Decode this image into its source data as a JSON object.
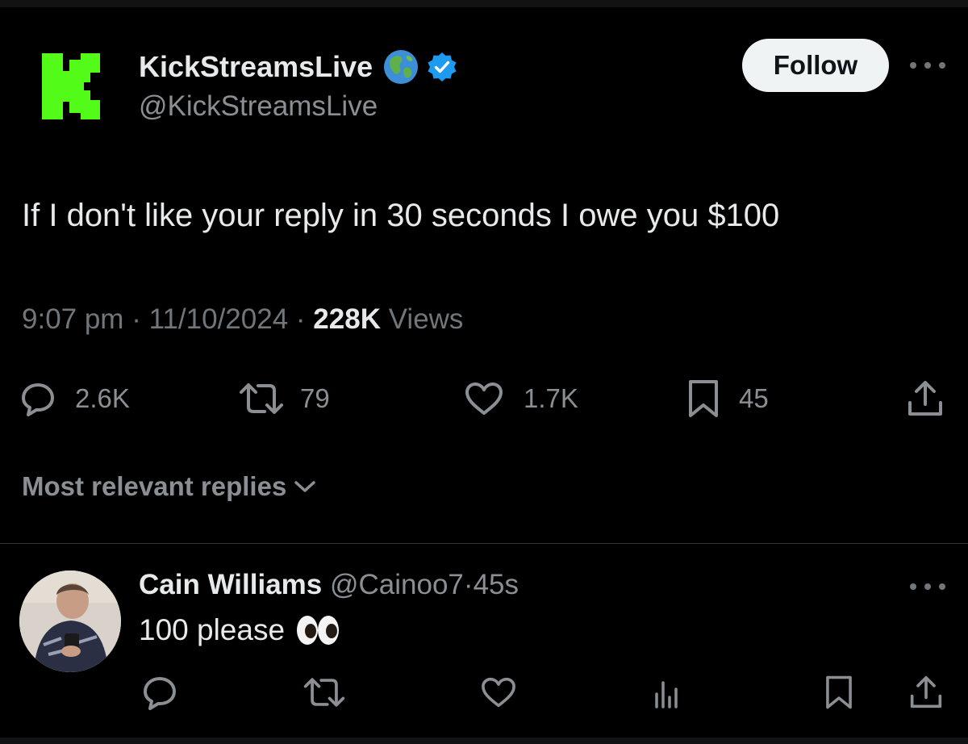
{
  "tweet": {
    "author_name": "KickStreamsLive",
    "author_handle": "@KickStreamsLive",
    "follow_label": "Follow",
    "text": "If I don't like your reply in 30 seconds I owe you $100",
    "time": "9:07 pm",
    "date": "11/10/2024",
    "views_count": "228K",
    "views_label": "Views",
    "separator": "·",
    "stats": {
      "replies": "2.6K",
      "reposts": "79",
      "likes": "1.7K",
      "bookmarks": "45"
    }
  },
  "replies_section": {
    "sort_label": "Most relevant replies"
  },
  "reply": {
    "name": "Cain Williams",
    "handle": "@Cainoo7",
    "time": "45s",
    "text": "100 please"
  },
  "icons": {
    "logo": "kick-logo",
    "globe": "globe-emoji",
    "verified": "verified-badge-icon",
    "reply": "speech-bubble-icon",
    "repost": "repost-icon",
    "like": "heart-icon",
    "bookmark": "bookmark-icon",
    "share": "share-icon",
    "views": "bar-chart-icon",
    "eyes": "eyes-emoji"
  },
  "colors": {
    "background": "#000000",
    "text_primary": "#e7e9ea",
    "text_secondary": "#71767b",
    "kick_green": "#53fc18",
    "verified_blue": "#1d9bf0",
    "follow_bg": "#eff3f4"
  }
}
